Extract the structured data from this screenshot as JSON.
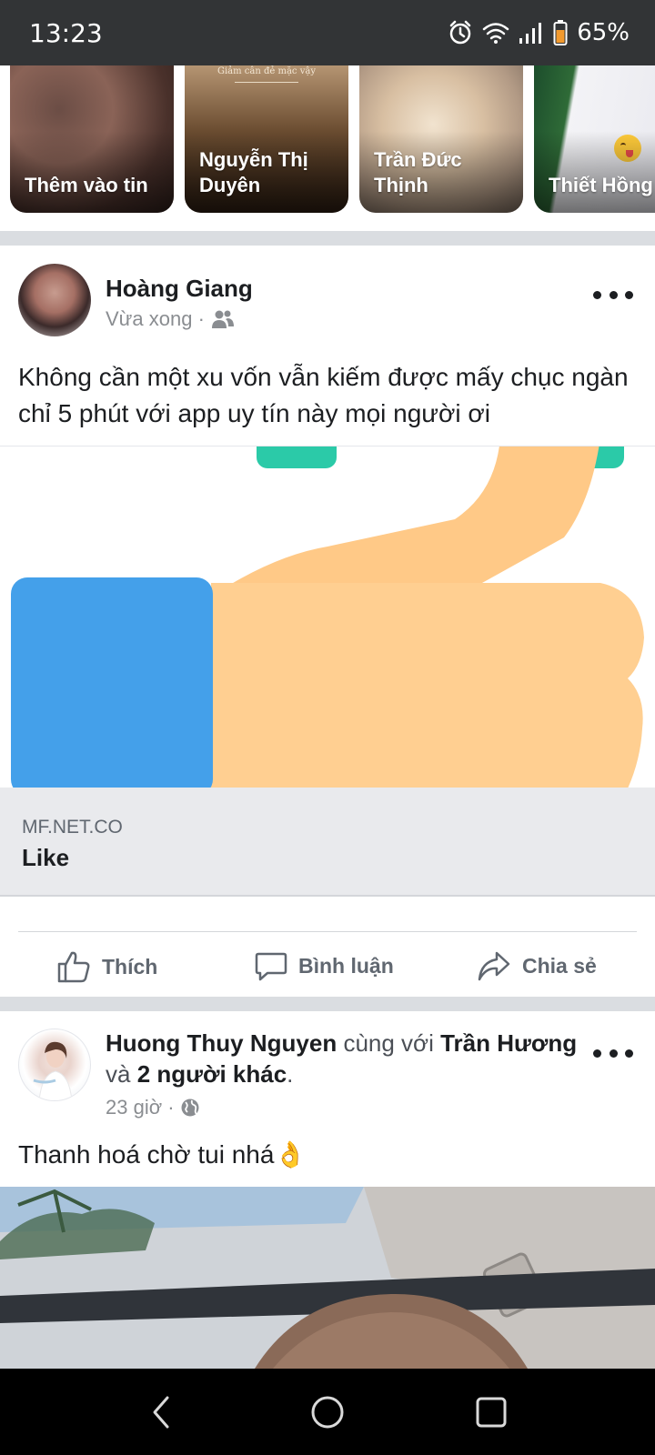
{
  "status_bar": {
    "time": "13:23",
    "battery": "65%",
    "icons": [
      "alarm-icon",
      "wifi-icon",
      "signal-icon",
      "battery-icon"
    ]
  },
  "stories": [
    {
      "label": "Thêm vào tin"
    },
    {
      "label": "Nguyễn Thị Duyên",
      "caption": "Giảm cân đẻ mặc vậy"
    },
    {
      "label": "Trần Đức Thịnh"
    },
    {
      "label": "Thiết Hồng"
    }
  ],
  "post1": {
    "author": "Hoàng Giang",
    "time": "Vừa xong ·",
    "audience_icon": "friends-icon",
    "text": "Không cần một xu vốn vẫn kiếm được mấy chục ngàn chỉ 5 phút với app uy tín này mọi người ơi",
    "image_icon": "thumbs-up-illustration",
    "link": {
      "domain": "MF.NET.CO",
      "title": "Like"
    },
    "actions": {
      "like": "Thích",
      "comment": "Bình luận",
      "share": "Chia sẻ"
    }
  },
  "post2": {
    "author": "Huong Thuy Nguyen",
    "with_word": "cùng với",
    "tagged": "Trần Hương",
    "and_word": "và",
    "others": "2 người khác",
    "period": ".",
    "time": "23 giờ ·",
    "audience_icon": "globe-icon",
    "text": "Thanh hoá chờ tui nhá👌"
  },
  "colors": {
    "status_bar": "#323436",
    "divider": "#dadde1",
    "link_preview_bg": "#e9eaed",
    "action_text": "#606770",
    "thumb_blue": "#44a0ea",
    "thumb_skin": "#ffc987",
    "thumb_teal": "#2bcaa8"
  },
  "nav": {
    "buttons": [
      "back-icon",
      "home-icon",
      "recents-icon"
    ]
  }
}
